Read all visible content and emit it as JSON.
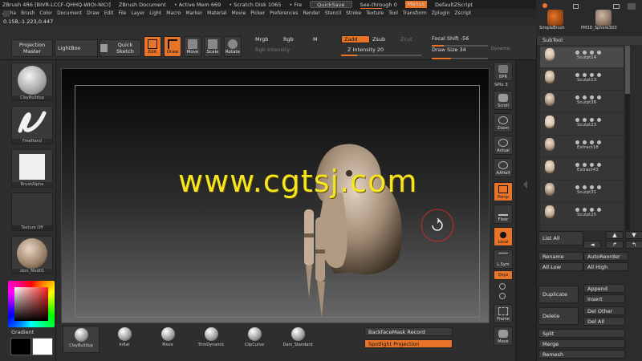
{
  "titlebar": {
    "app": "ZBrush 4R6 [BIVR-LCCF-QHHQ-WIOI-NICI]",
    "doc": "ZBrush Document",
    "mem": "• Active Mem 669",
    "disk": "• Scratch Disk 1065",
    "free": "• Fre",
    "quicksave": "QuickSave",
    "seethrough": "See-through  0",
    "menus": "Menus",
    "script": "DefaultZScript"
  },
  "menubar": [
    "Alpha",
    "Brush",
    "Color",
    "Document",
    "Draw",
    "Edit",
    "File",
    "Layer",
    "Light",
    "Macro",
    "Marker",
    "Material",
    "Movie",
    "Picker",
    "Preferences",
    "Render",
    "Stencil",
    "Stroke",
    "Texture",
    "Tool",
    "Transform",
    "Zplugin",
    "Zscript"
  ],
  "coords": "0.158,-1.223,0.447",
  "shelf": {
    "projection_master": "Projection Master",
    "lightbox": "LightBox",
    "quick_sketch": "Quick Sketch",
    "edit": "Edit",
    "draw": "Draw",
    "move": "Move",
    "scale": "Scale",
    "rotate": "Rotate",
    "mrgb": "Mrgb",
    "rgb": "Rgb",
    "m": "M",
    "rgb_intensity": "Rgb Intensity",
    "zadd": "Zadd",
    "zsub": "Zsub",
    "zcut": "Zcut",
    "z_intensity": "Z Intensity 20",
    "focal_shift": "Focal Shift -56",
    "draw_size": "Draw Size 34",
    "dynamic": "Dynamic",
    "z_intensity_level": 0.2,
    "focal_shift_level": 0.22,
    "draw_size_level": 0.34
  },
  "leftshelf": {
    "clay": "ClayBuildup",
    "freehand": "FreeHand",
    "alpha": "BrushAlpha",
    "texture": "Texture Off",
    "material": "zbro_Mod01",
    "gradient": "Gradient"
  },
  "watermark": "www.cgtsj.com",
  "rightshelf": {
    "brill": "BPR",
    "spix": "SPix 3",
    "scroll": "Scroll",
    "zoom": "Zoom",
    "actual": "Actual",
    "aahalf": "AAHalf",
    "persp": "Persp",
    "floor": "Floor",
    "local": "Local",
    "lsym": "L.Sym",
    "xyz": "Qxyz",
    "frame": "Frame",
    "move": "Move"
  },
  "topicons": {
    "simplebrush": "SimpleBrush",
    "pm3d": "PM3D_Sphere3D3"
  },
  "subtool": {
    "title": "SubTool",
    "items": [
      "Sculpt14",
      "Sculpt13",
      "Sculpt38",
      "Sculpt23",
      "Extract18",
      "Extract43",
      "Sculpt31",
      "Sculpt25"
    ]
  },
  "subtool_buttons": {
    "list_all": "List All",
    "rename": "Rename",
    "autoreorder": "AutoReorder",
    "all_low": "All Low",
    "all_high": "All High",
    "duplicate": "Duplicate",
    "append": "Append",
    "insert": "Insert",
    "delete": "Delete",
    "del_other": "Del Other",
    "del_all": "Del All",
    "split": "Split",
    "merge": "Merge",
    "remesh": "Remesh"
  },
  "bottomshelf": {
    "brushes": [
      "ClayBuildup",
      "Inflat",
      "Move",
      "TrimDynamic",
      "ClipCurve",
      "Dam_Standard"
    ],
    "backface": "BackfaceMask Record",
    "spotlight": "Spotlight Projection"
  },
  "colors": {
    "accent": "#e8742a",
    "watermark": "#f7e521"
  }
}
